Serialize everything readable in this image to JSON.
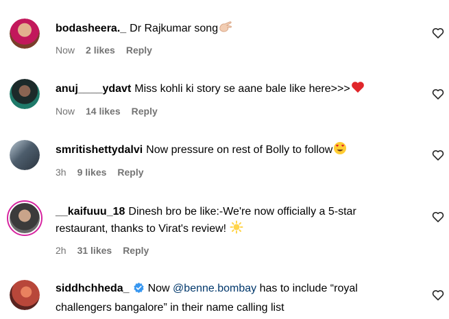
{
  "comments": [
    {
      "username": "bodasheera._",
      "text": "Dr Rajkumar song",
      "time": "Now",
      "likes": "2 likes",
      "reply": "Reply",
      "emoji": "hand-icon",
      "avatar_color": "#c98a6a"
    },
    {
      "username": "anuj____ydavt",
      "text": "Miss kohli ki story se aane bale like here>>>",
      "time": "Now",
      "likes": "14 likes",
      "reply": "Reply",
      "emoji": "red-heart-icon",
      "avatar_color": "#2f3a3a"
    },
    {
      "username": "smritishettydalvi",
      "text": "Now pressure on rest of Bolly to follow",
      "time": "3h",
      "likes": "9 likes",
      "reply": "Reply",
      "emoji": "heart-eyes-icon",
      "avatar_color": "#5b6b7a"
    },
    {
      "username": "__kaifuuu_18",
      "text_line1": "Dinesh bro be like:-We're now officially a 5-star",
      "text_line2": "restaurant, thanks to Virat's review!",
      "time": "2h",
      "likes": "31 likes",
      "reply": "Reply",
      "emoji": "sun-icon",
      "avatar_color": "#3b3b3b",
      "story_ring": true
    },
    {
      "username": "siddhchheda_",
      "verified": true,
      "text_pre": "Now",
      "mention": "@benne.bombay",
      "text_post_line1": "has to include “royal",
      "text_line2": "challengers bangalore” in their name calling list",
      "avatar_color": "#b8473a"
    }
  ]
}
